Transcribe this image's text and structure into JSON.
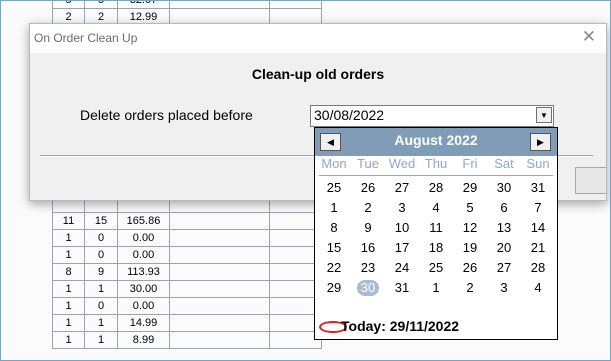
{
  "spreadsheet": {
    "rows": [
      [
        "5",
        "5",
        "32.67"
      ],
      [
        "2",
        "2",
        "12.99"
      ],
      [
        "",
        "",
        ""
      ],
      [
        "",
        "",
        ""
      ],
      [
        "",
        "",
        ""
      ],
      [
        "",
        "",
        ""
      ],
      [
        "",
        "",
        ""
      ],
      [
        "",
        "",
        ""
      ],
      [
        "",
        "",
        ""
      ],
      [
        "",
        "",
        ""
      ],
      [
        "",
        "",
        ""
      ],
      [
        "",
        "",
        ""
      ],
      [
        "",
        "",
        ""
      ],
      [
        "11",
        "15",
        "165.86"
      ],
      [
        "1",
        "0",
        "0.00"
      ],
      [
        "1",
        "0",
        "0.00"
      ],
      [
        "8",
        "9",
        "113.93"
      ],
      [
        "1",
        "1",
        "30.00"
      ],
      [
        "1",
        "0",
        "0.00"
      ],
      [
        "1",
        "1",
        "14.99"
      ],
      [
        "1",
        "1",
        "8.99"
      ]
    ]
  },
  "dialog": {
    "title": "On Order Clean Up",
    "close_glyph": "✕",
    "heading": "Clean-up old orders",
    "delete_label": "Delete orders placed before",
    "date_value": "30/08/2022",
    "dropdown_glyph": "▼"
  },
  "calendar": {
    "prev_glyph": "◀",
    "next_glyph": "▶",
    "month_label": "August 2022",
    "weekdays": [
      "Mon",
      "Tue",
      "Wed",
      "Thu",
      "Fri",
      "Sat",
      "Sun"
    ],
    "weeks": [
      [
        "25",
        "26",
        "27",
        "28",
        "29",
        "30",
        "31"
      ],
      [
        "1",
        "2",
        "3",
        "4",
        "5",
        "6",
        "7"
      ],
      [
        "8",
        "9",
        "10",
        "11",
        "12",
        "13",
        "14"
      ],
      [
        "15",
        "16",
        "17",
        "18",
        "19",
        "20",
        "21"
      ],
      [
        "22",
        "23",
        "24",
        "25",
        "26",
        "27",
        "28"
      ],
      [
        "29",
        "30",
        "31",
        "1",
        "2",
        "3",
        "4"
      ]
    ],
    "selected_day": "30",
    "today_label": "Today: 29/11/2022",
    "header_color": "#7f9db9",
    "weekday_color": "#8fa8c8",
    "selected_color": "#a9bcd3",
    "today_ring_color": "#e02020"
  }
}
